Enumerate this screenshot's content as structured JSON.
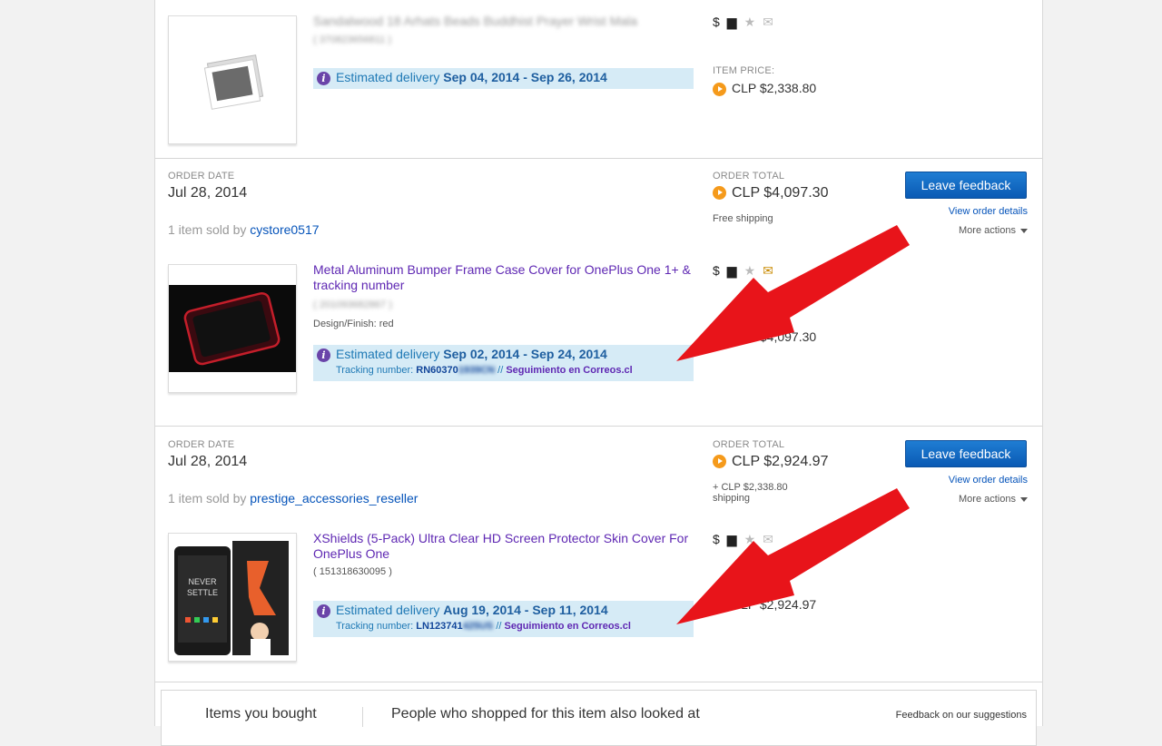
{
  "orders": [
    {
      "item": {
        "title": "Sandalwood 18 Arhats Beads Buddhist Prayer Wrist Mala",
        "item_number": "( 370823656811 )",
        "delivery_label": "Estimated delivery",
        "delivery_range": "Sep 04, 2014 - Sep 26, 2014",
        "price_label": "ITEM PRICE:",
        "price": "CLP $2,338.80",
        "icon_names": [
          "dollar-icon",
          "shipped-icon",
          "feedback-star-icon",
          "message-icon"
        ]
      }
    },
    {
      "order_date_label": "ORDER DATE",
      "order_date": "Jul 28, 2014",
      "sold_prefix": "1 item sold by",
      "seller": "cystore0517",
      "order_total_label": "ORDER TOTAL",
      "order_total": "CLP $4,097.30",
      "shipping": "Free shipping",
      "feedback_button": "Leave feedback",
      "view_details": "View order details",
      "more_actions": "More actions",
      "item": {
        "title": "Metal Aluminum Bumper Frame Case Cover for OnePlus One 1+ & tracking number",
        "item_number": "( 201093682867 )",
        "variation": "Design/Finish: red",
        "delivery_label": "Estimated delivery",
        "delivery_range": "Sep 02, 2014 - Sep 24, 2014",
        "tracking_label": "Tracking number:",
        "tracking_number": "RN60370",
        "tracking_hidden": "1939CN",
        "tracking_separator": "//",
        "tracking_link": "Seguimiento en Correos.cl",
        "price": "CLP $4,097.30"
      }
    },
    {
      "order_date_label": "ORDER DATE",
      "order_date": "Jul 28, 2014",
      "sold_prefix": "1 item sold by",
      "seller": "prestige_accessories_reseller",
      "order_total_label": "ORDER TOTAL",
      "order_total": "CLP $2,924.97",
      "shipping_amount": "+ CLP $2,338.80",
      "shipping": "shipping",
      "feedback_button": "Leave feedback",
      "view_details": "View order details",
      "more_actions": "More actions",
      "item": {
        "title": "XShields (5-Pack) Ultra Clear HD Screen Protector Skin Cover For OnePlus One",
        "item_number": "( 151318630095 )",
        "delivery_label": "Estimated delivery",
        "delivery_range": "Aug 19, 2014 - Sep 11, 2014",
        "tracking_label": "Tracking number:",
        "tracking_number": "LN123741",
        "tracking_hidden": "425US",
        "tracking_separator": "//",
        "tracking_link": "Seguimiento en Correos.cl",
        "price": "CLP $2,924.97",
        "packaging_text_1": "NEVER",
        "packaging_text_2": "SETTLE"
      }
    }
  ],
  "suggestions": {
    "tab_bought": "Items you bought",
    "heading": "People who shopped for this item also looked at",
    "feedback_link": "Feedback on our suggestions"
  },
  "colors": {
    "accent_blue": "#0654ba",
    "item_title_purple": "#5f28b3",
    "delivery_bg": "#d6ebf6",
    "annotation_red": "#e8141a",
    "button_blue": "#0a5ab4"
  }
}
